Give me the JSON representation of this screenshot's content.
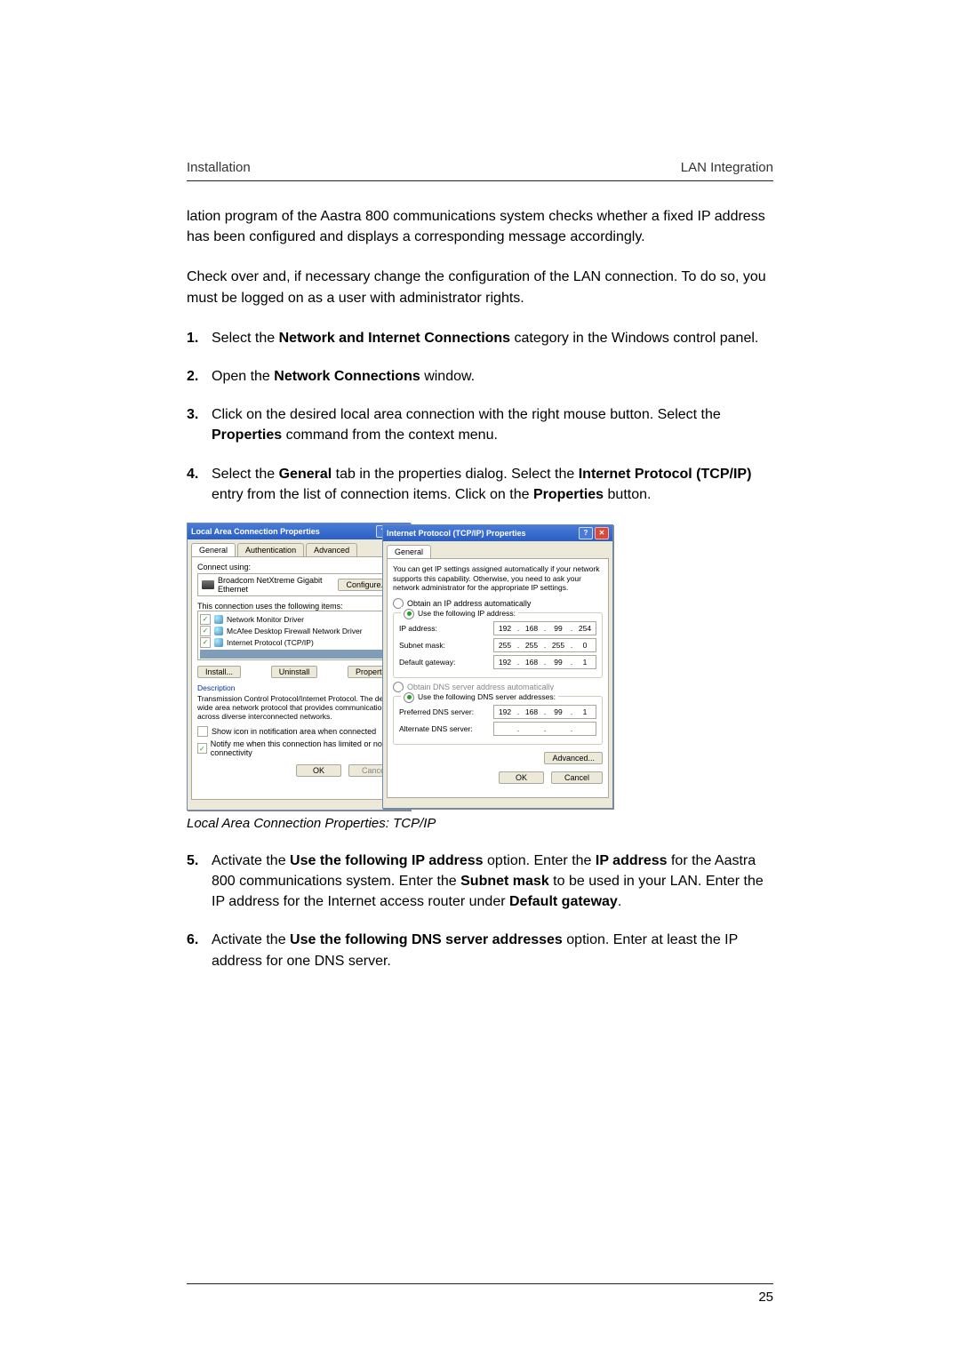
{
  "header": {
    "left": "Installation",
    "right": "LAN Integration"
  },
  "p1": "lation program of the Aastra 800 communications system checks whether a fixed IP address has been configured and displays a corresponding message accordingly.",
  "p2": "Check over and, if necessary change the configuration of the LAN connection. To do so, you must be logged on as a user with administrator rights.",
  "steps": {
    "s1a": "Select the ",
    "s1b": "Network and Internet Connections",
    "s1c": " category in the Windows control panel.",
    "s2a": "Open the ",
    "s2b": "Network Connections",
    "s2c": " window.",
    "s3a": "Click on the desired local area connection with the right mouse button. Select the ",
    "s3b": "Properties",
    "s3c": " command from the context menu.",
    "s4a": "Select the ",
    "s4b": "General",
    "s4c": " tab in the properties dialog. Select the ",
    "s4d": "Internet Protocol (TCP/IP)",
    "s4e": " entry from the list of connection items. Click on the ",
    "s4f": "Properties",
    "s4g": " button.",
    "s5a": "Activate the ",
    "s5b": "Use the following IP address",
    "s5c": " option. Enter the ",
    "s5d": "IP address",
    "s5e": " for the Aastra 800 communications system. Enter the ",
    "s5f": "Subnet mask",
    "s5g": " to be used in your LAN. Enter the IP address for the Internet access router under ",
    "s5h": "Default gateway",
    "s5i": ".",
    "s6a": "Activate the ",
    "s6b": "Use the following DNS server addresses",
    "s6c": " option. Enter at least the IP address for one DNS server."
  },
  "caption": "Local Area Connection Properties: TCP/IP",
  "pageNum": "25",
  "winA": {
    "title": "Local Area Connection Properties",
    "tabs": [
      "General",
      "Authentication",
      "Advanced"
    ],
    "connectUsing": "Connect using:",
    "adapter": "Broadcom NetXtreme Gigabit Ethernet",
    "configure": "Configure...",
    "usesItems": "This connection uses the following items:",
    "items": [
      "Network Monitor Driver",
      "McAfee Desktop Firewall Network Driver",
      "Internet Protocol (TCP/IP)"
    ],
    "install": "Install...",
    "uninstall": "Uninstall",
    "properties": "Properties",
    "descLabel": "Description",
    "descText": "Transmission Control Protocol/Internet Protocol. The default wide area network protocol that provides communication across diverse interconnected networks.",
    "showIcon": "Show icon in notification area when connected",
    "notify": "Notify me when this connection has limited or no connectivity",
    "ok": "OK",
    "cancel": "Cancel"
  },
  "winB": {
    "title": "Internet Protocol (TCP/IP) Properties",
    "tab": "General",
    "intro": "You can get IP settings assigned automatically if your network supports this capability. Otherwise, you need to ask your network administrator for the appropriate IP settings.",
    "obtainIp": "Obtain an IP address automatically",
    "useIp": "Use the following IP address:",
    "ipLabel": "IP address:",
    "ip": [
      "192",
      "168",
      "99",
      "254"
    ],
    "maskLabel": "Subnet mask:",
    "mask": [
      "255",
      "255",
      "255",
      "0"
    ],
    "gwLabel": "Default gateway:",
    "gw": [
      "192",
      "168",
      "99",
      "1"
    ],
    "obtainDns": "Obtain DNS server address automatically",
    "useDns": "Use the following DNS server addresses:",
    "pdnsLabel": "Preferred DNS server:",
    "pdns": [
      "192",
      "168",
      "99",
      "1"
    ],
    "adnsLabel": "Alternate DNS server:",
    "advanced": "Advanced...",
    "ok": "OK",
    "cancel": "Cancel"
  }
}
